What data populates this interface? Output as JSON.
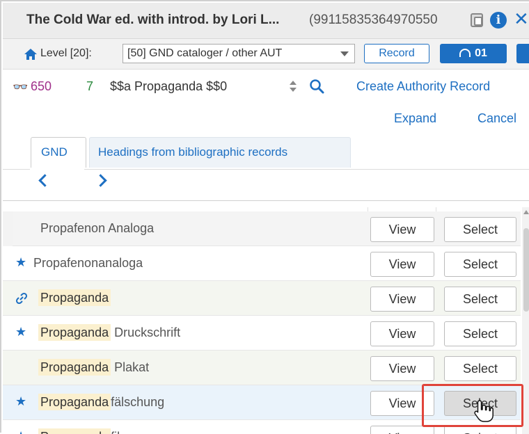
{
  "window": {
    "title": "The Cold War ed. with introd. by Lori L...",
    "record_id": "(99115835364970550",
    "colors": {
      "accent": "#1d6fc2",
      "callout": "#e0443a",
      "highlight": "#fbf0cf"
    }
  },
  "levelbar": {
    "level_label": "Level [20]:",
    "level_value": "[50] GND cataloger / other AUT",
    "record_button": "Record",
    "counter_button": "01"
  },
  "field": {
    "tag": "650",
    "indicator": "7",
    "subfields": "$$a Propaganda $$0",
    "create_link": "Create Authority Record"
  },
  "actions": {
    "expand": "Expand",
    "cancel": "Cancel"
  },
  "tabs": [
    {
      "label": "GND"
    },
    {
      "label": "Headings from bibliographic records"
    }
  ],
  "results": {
    "rows": [
      {
        "mark": "",
        "highlight": "",
        "rest": "Propafenon Analoga",
        "view": "View",
        "select": "Select"
      },
      {
        "mark": "star",
        "highlight": "",
        "rest": "Propafenonanaloga",
        "view": "View",
        "select": "Select"
      },
      {
        "mark": "link",
        "highlight": "Propaganda",
        "rest": "",
        "view": "View",
        "select": "Select"
      },
      {
        "mark": "star",
        "highlight": "Propaganda",
        "rest": " Druckschrift",
        "view": "View",
        "select": "Select"
      },
      {
        "mark": "",
        "highlight": "Propaganda",
        "rest": " Plakat",
        "view": "View",
        "select": "Select"
      },
      {
        "mark": "star",
        "highlight": "Propaganda",
        "rest": "fälschung",
        "view": "View",
        "select": "Select"
      },
      {
        "mark": "star",
        "highlight": "Propaganda",
        "rest": "film",
        "view": "View",
        "select": "Select"
      }
    ]
  }
}
